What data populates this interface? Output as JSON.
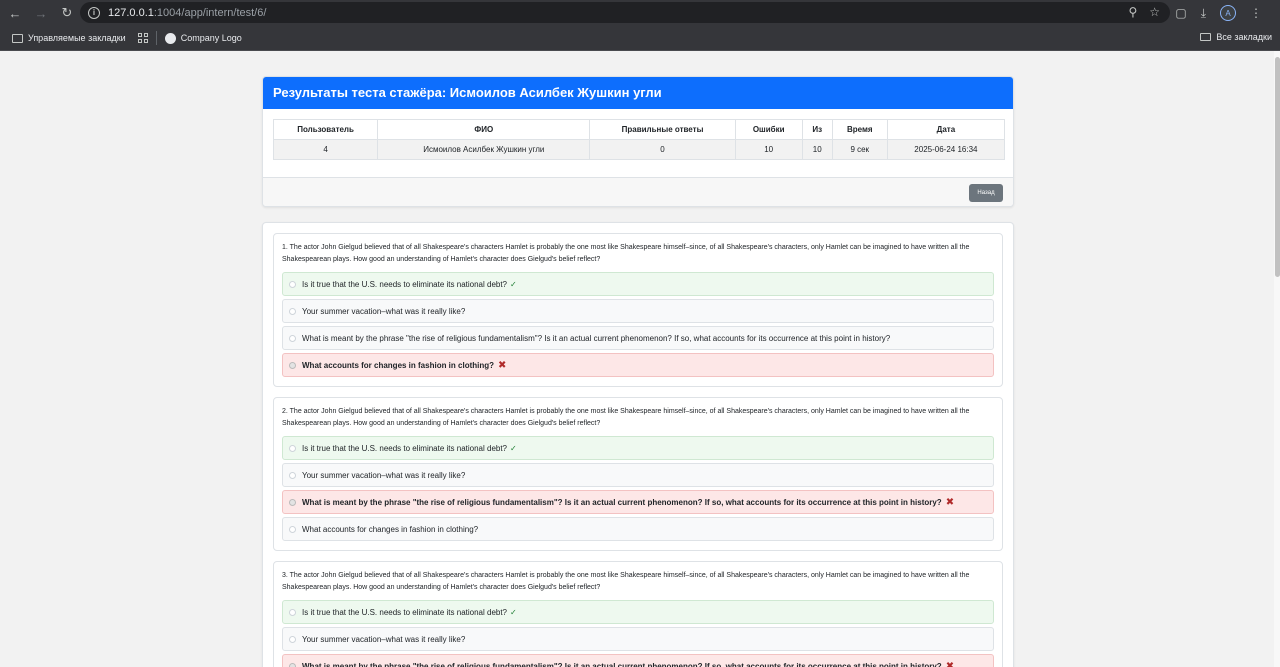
{
  "browser": {
    "url_host": "127.0.0.1",
    "url_path": ":1004/app/intern/test/6/",
    "bookmarks": [
      "Управляемые закладки",
      "Company Logo"
    ],
    "all_bookmarks": "Все закладки",
    "profile_initial": "A"
  },
  "results": {
    "title": "Результаты теста стажёра: Исмоилов Асилбек Жушкин угли",
    "columns": [
      "Пользователь",
      "ФИО",
      "Правильные ответы",
      "Ошибки",
      "Из",
      "Время",
      "Дата"
    ],
    "row": [
      "4",
      "Исмоилов Асилбек Жушкин угли",
      "0",
      "10",
      "10",
      "9 сек",
      "2025-06-24 16:34"
    ],
    "back_label": "Назад"
  },
  "questions": [
    {
      "text": "1. The actor John Gielgud believed that of all Shakespeare's characters Hamlet is probably the one most like Shakespeare himself–since, of all Shakespeare's characters, only Hamlet can be imagined to have written all the Shakespearean plays. How good an understanding of Hamlet's character does Gielgud's belief reflect?",
      "options": [
        {
          "text": "Is it true that the U.S. needs to eliminate its national debt?",
          "state": "correct"
        },
        {
          "text": "Your summer vacation–what was it really like?",
          "state": "none"
        },
        {
          "text": "What is meant by the phrase \"the rise of religious fundamentalism\"? Is it an actual current phenomenon? If so, what accounts for its occurrence at this point in history?",
          "state": "none"
        },
        {
          "text": "What accounts for changes in fashion in clothing?",
          "state": "wrong"
        }
      ]
    },
    {
      "text": "2. The actor John Gielgud believed that of all Shakespeare's characters Hamlet is probably the one most like Shakespeare himself–since, of all Shakespeare's characters, only Hamlet can be imagined to have written all the Shakespearean plays. How good an understanding of Hamlet's character does Gielgud's belief reflect?",
      "options": [
        {
          "text": "Is it true that the U.S. needs to eliminate its national debt?",
          "state": "correct"
        },
        {
          "text": "Your summer vacation–what was it really like?",
          "state": "none"
        },
        {
          "text": "What is meant by the phrase \"the rise of religious fundamentalism\"? Is it an actual current phenomenon? If so, what accounts for its occurrence at this point in history?",
          "state": "wrong"
        },
        {
          "text": "What accounts for changes in fashion in clothing?",
          "state": "none"
        }
      ]
    },
    {
      "text": "3. The actor John Gielgud believed that of all Shakespeare's characters Hamlet is probably the one most like Shakespeare himself–since, of all Shakespeare's characters, only Hamlet can be imagined to have written all the Shakespearean plays. How good an understanding of Hamlet's character does Gielgud's belief reflect?",
      "options": [
        {
          "text": "Is it true that the U.S. needs to eliminate its national debt?",
          "state": "correct"
        },
        {
          "text": "Your summer vacation–what was it really like?",
          "state": "none"
        },
        {
          "text": "What is meant by the phrase \"the rise of religious fundamentalism\"? Is it an actual current phenomenon? If so, what accounts for its occurrence at this point in history?",
          "state": "wrong"
        }
      ]
    }
  ],
  "colors": {
    "header_blue": "#0d6efd",
    "correct_bg": "#eef9ef",
    "wrong_bg": "#fde7e7"
  }
}
